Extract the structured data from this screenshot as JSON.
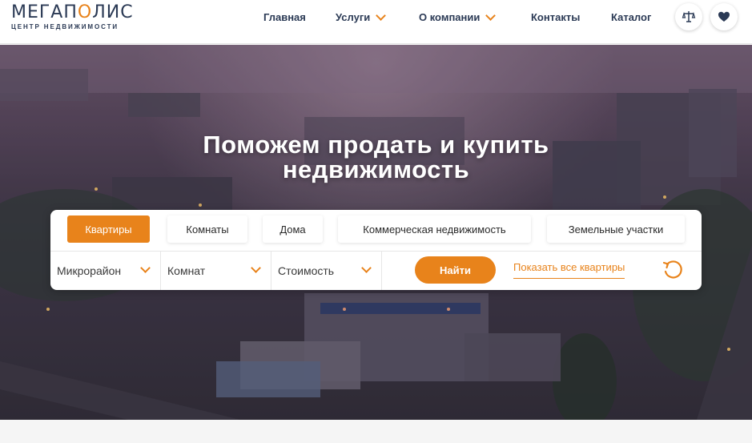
{
  "header": {
    "logo_main_a": "МЕГАП",
    "logo_main_accent": "О",
    "logo_main_b": "ЛИС",
    "logo_sub": "ЦЕНТР НЕДВИЖИМОСТИ",
    "nav": [
      {
        "label": "Главная",
        "has_dropdown": false
      },
      {
        "label": "Услуги",
        "has_dropdown": true
      },
      {
        "label": "О компании",
        "has_dropdown": true
      },
      {
        "label": "Контакты",
        "has_dropdown": false
      },
      {
        "label": "Каталог",
        "has_dropdown": false
      }
    ],
    "icons": [
      "scales-icon",
      "heart-icon"
    ]
  },
  "hero": {
    "title_line1": "Поможем продать и купить",
    "title_line2": "недвижимость"
  },
  "search": {
    "tabs": [
      {
        "label": "Квартиры",
        "active": true
      },
      {
        "label": "Комнаты",
        "active": false
      },
      {
        "label": "Дома",
        "active": false
      },
      {
        "label": "Коммерческая недвижимость",
        "active": false
      },
      {
        "label": "Земельные участки",
        "active": false
      }
    ],
    "filters": [
      {
        "label": "Микрорайон"
      },
      {
        "label": "Комнат"
      },
      {
        "label": "Стоимость"
      }
    ],
    "find_label": "Найти",
    "show_all_label": "Показать все квартиры",
    "reset_icon": "reset-icon"
  },
  "colors": {
    "accent": "#e8831b",
    "brand_dark": "#2b3a55"
  }
}
